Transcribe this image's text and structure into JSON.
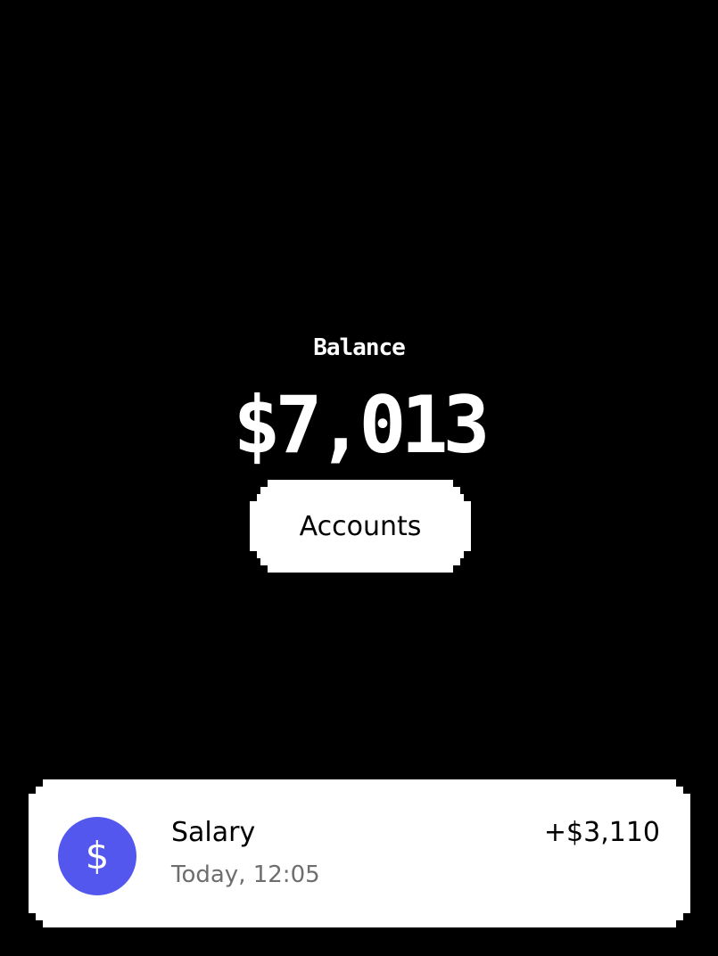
{
  "balance": {
    "label": "Balance",
    "amount": "$7,013"
  },
  "accounts_button": {
    "label": "Accounts"
  },
  "transaction": {
    "icon": "dollar-icon",
    "icon_glyph": "$",
    "title": "Salary",
    "time": "Today, 12:05",
    "amount": "+$3,110"
  },
  "colors": {
    "background": "#000000",
    "card": "#ffffff",
    "accent": "#5457ee",
    "muted_text": "#6e6e6e"
  }
}
